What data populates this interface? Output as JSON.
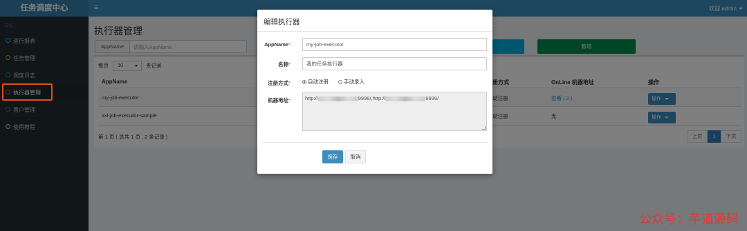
{
  "app": {
    "logo": "任务调度中心",
    "welcome": "欢迎 admin"
  },
  "sidebar": {
    "header": "导航",
    "items": [
      {
        "label": "运行报表",
        "color": "#00c0ef"
      },
      {
        "label": "任务管理",
        "color": "#f39c12"
      },
      {
        "label": "调度日志",
        "color": "#00a65a"
      },
      {
        "label": "执行器管理",
        "color": "#dd4b39"
      },
      {
        "label": "用户管理",
        "color": "#605ca8"
      },
      {
        "label": "使用教程",
        "color": "#d2d6de"
      }
    ],
    "active_index": 3
  },
  "main": {
    "title": "执行器管理",
    "filter_label": "AppName",
    "filter_placeholder": "请输入AppName",
    "add_button": "新增",
    "perpage_prefix": "每页",
    "perpage_value": "10",
    "perpage_suffix": "条记录",
    "columns": [
      "AppName",
      "注册方式",
      "OnLine 机器地址",
      "操作"
    ],
    "rows": [
      {
        "appname": "my-job-executor",
        "reg": "动注册",
        "online": "查看 ( 2 )",
        "op": "操作"
      },
      {
        "appname": "xxl-job-executor-sample",
        "reg": "动注册",
        "online": "无",
        "op": "操作"
      }
    ],
    "page_info": "第 1 页 ( 总共 1 页 , 2 条记录 )",
    "pager": {
      "prev": "上页",
      "current": "1",
      "next": "下页"
    }
  },
  "modal": {
    "title": "编辑执行器",
    "appname_label": "AppName",
    "appname_value": "my-job-executor",
    "name_label": "名称",
    "name_value": "我的任务执行器",
    "reg_label": "注册方式",
    "reg_auto": "自动注册",
    "reg_manual": "手动录入",
    "addr_label": "机器地址",
    "addr_part1": "http://",
    "addr_part2": "9998/,http://",
    "addr_part3": "9999/",
    "required_mark": "*",
    "save": "保存",
    "cancel": "取消"
  },
  "watermark": "公众号：芋道源码"
}
